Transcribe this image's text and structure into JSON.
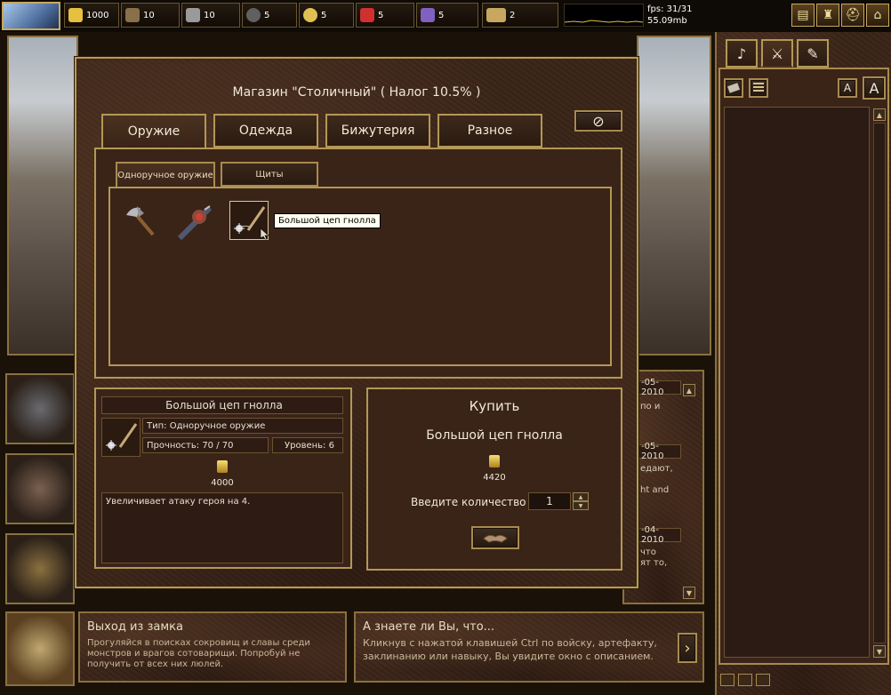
{
  "resources": [
    {
      "name": "gold",
      "value": "1000",
      "color": "#e8c040"
    },
    {
      "name": "wood",
      "value": "10",
      "color": "#8a7048"
    },
    {
      "name": "ore",
      "value": "10",
      "color": "#9a9a9a"
    },
    {
      "name": "mercury",
      "value": "5",
      "color": "#b0b0c0"
    },
    {
      "name": "sulfur",
      "value": "5",
      "color": "#e0c050"
    },
    {
      "name": "crystals",
      "value": "5",
      "color": "#d03030"
    },
    {
      "name": "gems",
      "value": "5",
      "color": "#8060c0"
    }
  ],
  "army_count": "2",
  "perf": {
    "fps": "fps: 31/31",
    "mem": "55.09mb"
  },
  "shop": {
    "title": "Магазин \"Столичный\" ( Налог 10.5% )",
    "tabs": [
      "Оружие",
      "Одежда",
      "Бижутерия",
      "Разное"
    ],
    "active_tab": "Оружие",
    "subtabs": [
      "Одноручное оружие",
      "Щиты"
    ],
    "tooltip": "Большой цеп гнолла",
    "items": [
      "axe",
      "spiked-mace",
      "gnoll-flail"
    ]
  },
  "details": {
    "name": "Большой цеп гнолла",
    "type": "Тип: Одноручное оружие",
    "durability": "Прочность: 70 / 70",
    "level": "Уровень: 6",
    "price": "4000",
    "description": "Увеличивает атаку героя на 4."
  },
  "buy": {
    "title": "Купить",
    "item": "Большой цеп гнолла",
    "price": "4420",
    "qty_label": "Введите количество",
    "qty": "1"
  },
  "log_fragments": [
    {
      "date": "-05-2010",
      "lines": [
        "по и",
        ""
      ]
    },
    {
      "date": "-05-2010",
      "lines": [
        "едают,",
        "",
        "ht and"
      ]
    },
    {
      "date": "-04-2010",
      "lines": [
        "что",
        "ят то,"
      ]
    }
  ],
  "exit": {
    "title": "Выход из замка",
    "text": "Прогуляйся в поисках сокровищ и славы среди монстров и врагов сотоварищи. Попробуй не получить от всех них люлей."
  },
  "tip": {
    "title": "А знаете ли Вы, что...",
    "text": "Кликнув с нажатой клавишей Ctrl по войску, артефакту, заклинанию или навыку, Вы увидите окно с описанием."
  },
  "font_buttons": [
    "A",
    "A"
  ],
  "accent": "#b89a5a"
}
